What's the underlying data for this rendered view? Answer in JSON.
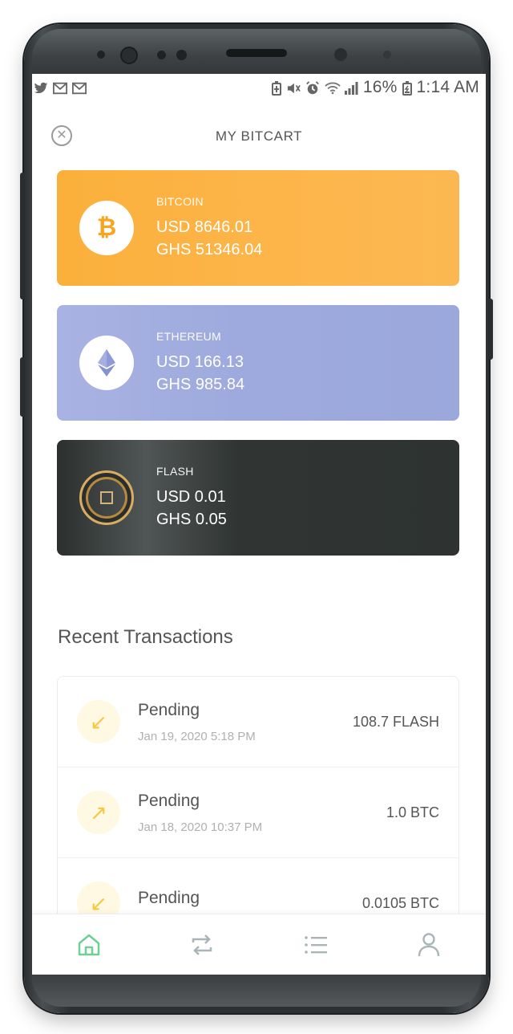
{
  "statusbar": {
    "left_icons": [
      "twitter-icon",
      "gmail-icon",
      "gmail-icon"
    ],
    "battery_percent": "16%",
    "time": "1:14 AM"
  },
  "header": {
    "title": "MY BITCART",
    "close_icon": "close-circle-icon"
  },
  "coins": [
    {
      "name": "BITCOIN",
      "usd": "USD 8646.01",
      "ghs": "GHS 51346.04",
      "icon": "bitcoin-icon",
      "color": "#fbb03b"
    },
    {
      "name": "ETHEREUM",
      "usd": "USD 166.13",
      "ghs": "GHS 985.84",
      "icon": "ethereum-icon",
      "color": "#a3aee0"
    },
    {
      "name": "FLASH",
      "usd": "USD 0.01",
      "ghs": "GHS 0.05",
      "icon": "flash-coin-icon",
      "color": "#2e3331"
    }
  ],
  "recent": {
    "title": "Recent Transactions",
    "items": [
      {
        "status": "Pending",
        "date": "Jan 19, 2020 5:18 PM",
        "amount": "108.7 FLASH",
        "direction": "incoming",
        "icon": "arrow-down-left-icon"
      },
      {
        "status": "Pending",
        "date": "Jan 18, 2020 10:37 PM",
        "amount": "1.0 BTC",
        "direction": "outgoing",
        "icon": "arrow-up-right-icon"
      },
      {
        "status": "Pending",
        "date": "",
        "amount": "0.0105 BTC",
        "direction": "incoming",
        "icon": "arrow-down-left-icon"
      }
    ]
  },
  "nav": {
    "items": [
      "home-icon",
      "exchange-icon",
      "list-icon",
      "profile-icon"
    ],
    "active": "home-icon",
    "active_color": "#6fcf97",
    "inactive_color": "#a9b5b6"
  }
}
